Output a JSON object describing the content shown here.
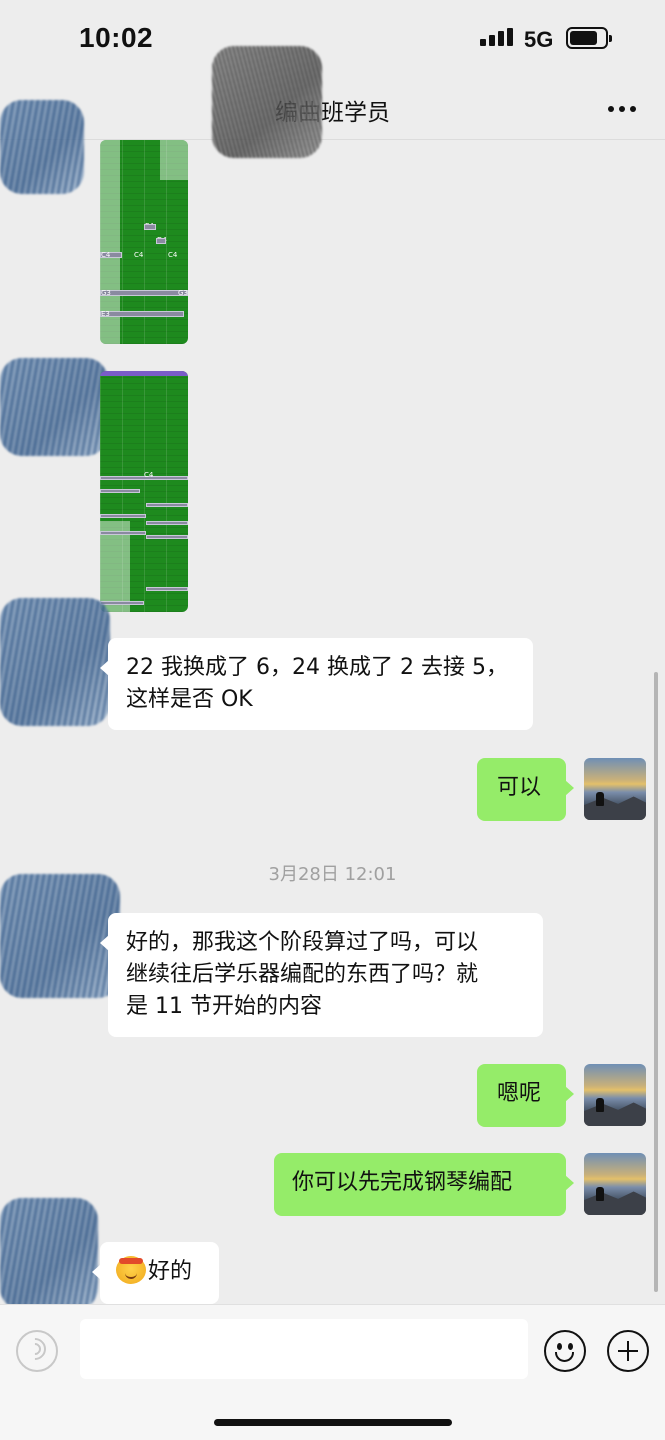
{
  "status_bar": {
    "time": "10:02",
    "network": "5G",
    "battery_level": 0.8
  },
  "header": {
    "title": "编曲班学员",
    "more_icon": "more-horizontal-icon"
  },
  "images": [
    {
      "name": "piano-roll-screenshot-1",
      "note_labels": [
        "E4",
        "D4",
        "C4",
        "C4",
        "C4",
        "G3",
        "G3",
        "E3"
      ]
    },
    {
      "name": "piano-roll-screenshot-2",
      "note_labels": [
        "C4"
      ]
    }
  ],
  "messages": [
    {
      "side": "left",
      "text_lines": [
        "22 我换成了 6，24 换成了 2 去接 5，",
        "这样是否 OK"
      ]
    },
    {
      "side": "right",
      "text": "可以"
    },
    {
      "side": "left",
      "text_lines": [
        "好的，那我这个阶段算过了吗，可以",
        "继续往后学乐器编配的东西了吗？就",
        "是 11 节开始的内容"
      ]
    },
    {
      "side": "right",
      "text": "嗯呢"
    },
    {
      "side": "right",
      "text": "你可以先完成钢琴编配"
    },
    {
      "side": "left",
      "text": "好的",
      "emoji": "hand-over-mouth-emoji"
    }
  ],
  "timestamp": "3月28日 12:01",
  "input_bar": {
    "voice_icon": "voice-icon",
    "input_value": "",
    "emoji_icon": "emoji-icon",
    "plus_icon": "plus-icon"
  },
  "colors": {
    "background": "#ededed",
    "my_bubble": "#95ec69",
    "their_bubble": "#ffffff",
    "timestamp_text": "#a0a0a0"
  }
}
